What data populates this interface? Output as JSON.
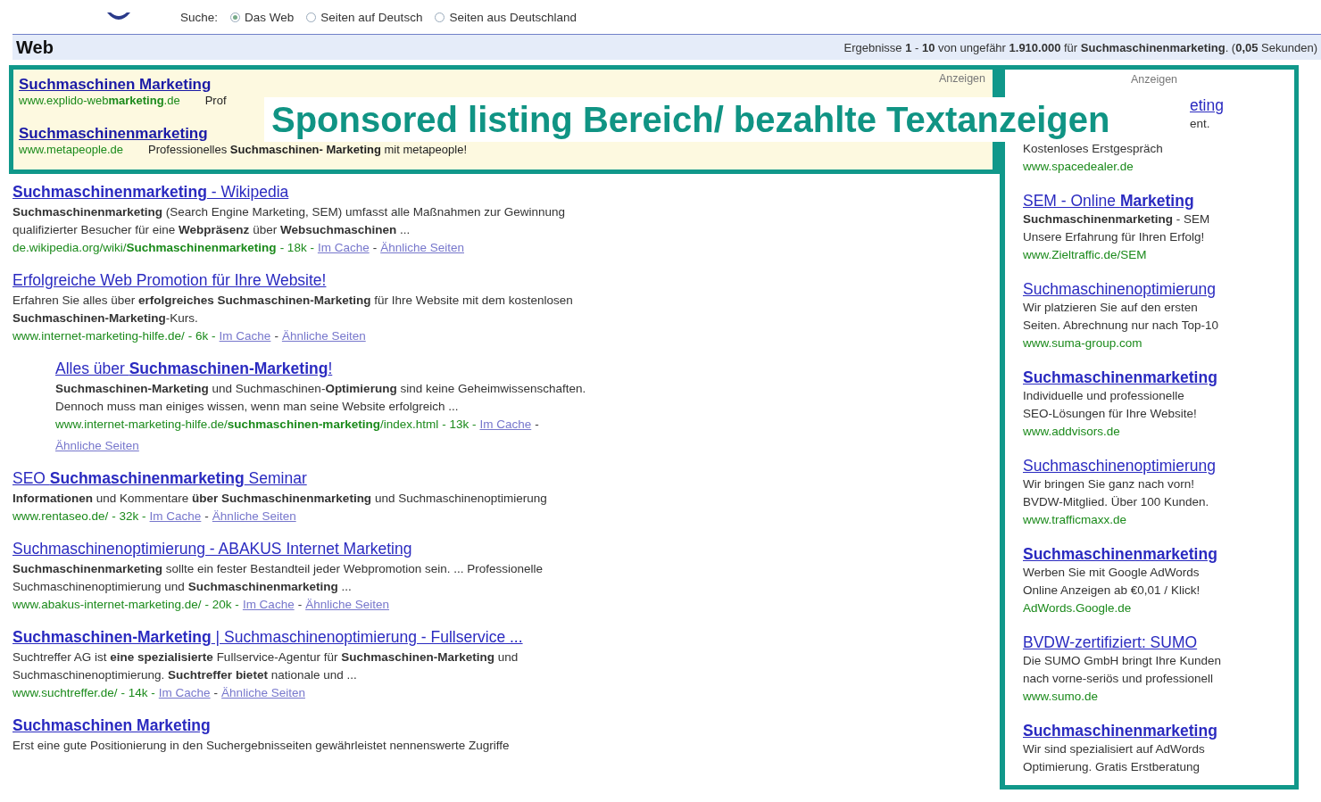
{
  "search_options": {
    "label": "Suche:",
    "options": [
      {
        "label": "Das Web",
        "selected": true
      },
      {
        "label": "Seiten auf Deutsch",
        "selected": false
      },
      {
        "label": "Seiten aus Deutschland",
        "selected": false
      }
    ]
  },
  "results_bar": {
    "title": "Web",
    "summary": "Ergebnisse **1** - **10** von ungefähr **1.910.000** für **Suchmaschinenmarketing**. (**0,05** Sekunden)"
  },
  "top_ads": {
    "label": "Anzeigen",
    "ads": [
      {
        "title": "Suchmaschinen Marketing",
        "url": "www.explido-web**marketing**.de",
        "description": "Prof"
      },
      {
        "title": "Suchmaschinenmarketing",
        "url": "www.metapeople.de",
        "description": "Professionelles **Suchmaschinen- Marketing** mit metapeople!"
      }
    ]
  },
  "annotation": "Sponsored listing Bereich/ bezahlte Textanzeigen",
  "results": [
    {
      "title": "**Suchmaschinenmarketing** - Wikipedia",
      "snippet": "**Suchmaschinenmarketing** (Search Engine Marketing, SEM) umfasst alle Maßnahmen zur Gewinnung qualifizierter Besucher für eine **Webpräsenz** über **Websuchmaschinen** ...",
      "url": "de.wikipedia.org/wiki/**Suchmaschinenmarketing**",
      "size": "- 18k -",
      "separator": "-",
      "links": [
        "Im Cache",
        "Ähnliche Seiten"
      ]
    },
    {
      "title": "Erfolgreiche Web Promotion für Ihre Website!",
      "snippet": "Erfahren Sie alles über **erfolgreiches Suchmaschinen-Marketing** für Ihre Website mit dem kostenlosen **Suchmaschinen-Marketing**-Kurs.",
      "url": "www.internet-marketing-hilfe.de/",
      "size": "- 6k -",
      "separator": "-",
      "links": [
        "Im Cache",
        "Ähnliche Seiten"
      ],
      "children": [
        {
          "title": "Alles über **Suchmaschinen-Marketing**!",
          "snippet": "**Suchmaschinen-Marketing** und Suchmaschinen-**Optimierung** sind keine Geheimwissenschaften. Dennoch muss man einiges wissen, wenn man seine Website erfolgreich ...",
          "url": "www.internet-marketing-hilfe.de/**suchmaschinen-marketing**/index.html",
          "size": "- 13k -",
          "separator": "-",
          "links": [
            "Im Cache",
            "Ähnliche Seiten"
          ]
        }
      ]
    },
    {
      "title": "SEO **Suchmaschinenmarketing** Seminar",
      "snippet": "**Informationen** und Kommentare **über Suchmaschinenmarketing** und Suchmaschinenoptimierung",
      "url": "www.rentaseo.de/",
      "size": "- 32k -",
      "separator": "-",
      "links": [
        "Im Cache",
        "Ähnliche Seiten"
      ]
    },
    {
      "title": "Suchmaschinenoptimierung - ABAKUS Internet Marketing",
      "snippet": "**Suchmaschinenmarketing** sollte ein fester Bestandteil jeder Webpromotion sein. ... Professionelle Suchmaschinenoptimierung und **Suchmaschinenmarketing** ...",
      "url": "www.abakus-internet-marketing.de/",
      "size": "- 20k -",
      "separator": "-",
      "links": [
        "Im Cache",
        "Ähnliche Seiten"
      ]
    },
    {
      "title": "**Suchmaschinen-Marketing** | Suchmaschinenoptimierung - Fullservice ...",
      "snippet": "Suchtreffer AG ist **eine spezialisierte** Fullservice-Agentur für **Suchmaschinen-Marketing** und Suchmaschinenoptimierung. **Suchtreffer bietet** nationale und ...",
      "url": "www.suchtreffer.de/",
      "size": "- 14k -",
      "separator": "-",
      "links": [
        "Im Cache",
        "Ähnliche Seiten"
      ]
    },
    {
      "title": "**Suchmaschinen Marketing**",
      "snippet": "Erst eine gute Positionierung in den Suchergebnisseiten gewährleistet nennenswerte Zugriffe"
    }
  ],
  "side_ads": {
    "label": "Anzeigen",
    "ads": [
      {
        "title": "eting",
        "lines": [
          "ent.",
          "Kostenloses Erstgespräch"
        ],
        "url": "www.spacedealer.de"
      },
      {
        "title": "SEM - Online **Marketing**",
        "lines": [
          "**Suchmaschinenmarketing** - SEM",
          "Unsere Erfahrung für Ihren Erfolg!"
        ],
        "url": "www.Zieltraffic.de/SEM"
      },
      {
        "title": "Suchmaschinenoptimierung",
        "lines": [
          "Wir platzieren Sie auf den ersten",
          "Seiten. Abrechnung nur nach Top-10"
        ],
        "url": "www.suma-group.com"
      },
      {
        "title": "**Suchmaschinenmarketing**",
        "lines": [
          "Individuelle und professionelle",
          "SEO-Lösungen für Ihre Website!"
        ],
        "url": "www.addvisors.de"
      },
      {
        "title": "Suchmaschinenoptimierung",
        "lines": [
          "Wir bringen Sie ganz nach vorn!",
          "BVDW-Mitglied. Über 100 Kunden."
        ],
        "url": "www.trafficmaxx.de"
      },
      {
        "title": "**Suchmaschinenmarketing**",
        "lines": [
          "Werben Sie mit Google AdWords",
          "Online Anzeigen ab €0,01 / Klick!"
        ],
        "url": "AdWords.Google.de"
      },
      {
        "title": "BVDW-zertifiziert: SUMO",
        "lines": [
          "Die SUMO GmbH bringt Ihre Kunden",
          "nach vorne-seriös und professionell"
        ],
        "url": "www.sumo.de"
      },
      {
        "title": "**Suchmaschinenmarketing**",
        "lines": [
          "Wir sind spezialisiert auf AdWords",
          "Optimierung. Gratis Erstberatung"
        ]
      }
    ]
  }
}
